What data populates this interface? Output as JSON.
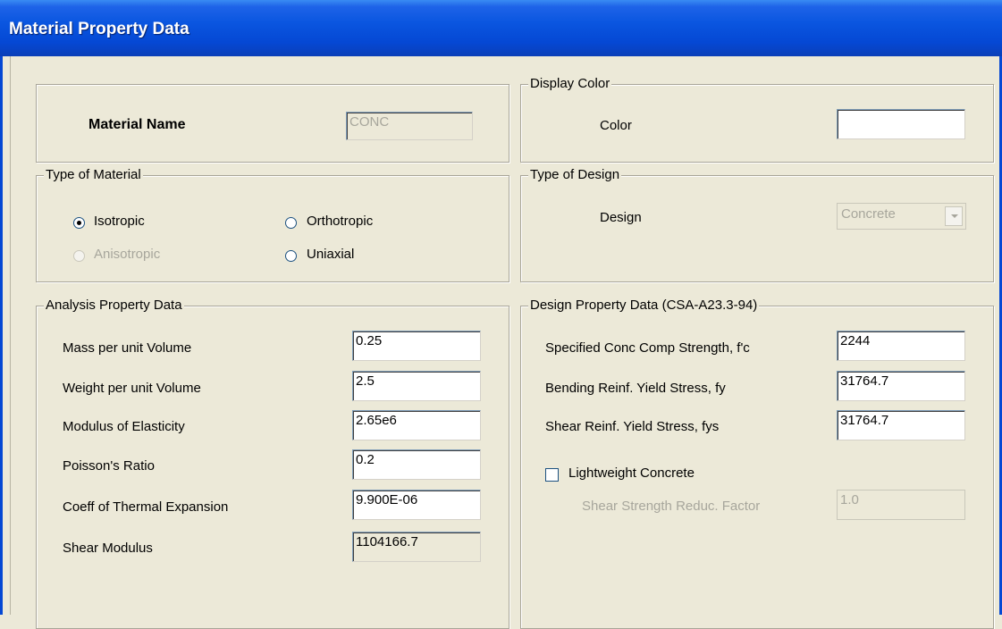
{
  "window": {
    "title": "Material Property Data"
  },
  "material_name": {
    "label": "Material Name",
    "value": "CONC"
  },
  "display_color": {
    "legend": "Display Color",
    "label": "Color",
    "value": ""
  },
  "type_of_material": {
    "legend": "Type of Material",
    "options": [
      {
        "label": "Isotropic",
        "checked": true,
        "enabled": true
      },
      {
        "label": "Orthotropic",
        "checked": false,
        "enabled": true
      },
      {
        "label": "Anisotropic",
        "checked": false,
        "enabled": false
      },
      {
        "label": "Uniaxial",
        "checked": false,
        "enabled": true
      }
    ]
  },
  "type_of_design": {
    "legend": "Type of Design",
    "label": "Design",
    "value": "Concrete"
  },
  "analysis": {
    "legend": "Analysis Property Data",
    "rows": [
      {
        "label": "Mass per unit Volume",
        "value": "0.25"
      },
      {
        "label": "Weight per unit Volume",
        "value": "2.5"
      },
      {
        "label": "Modulus of Elasticity",
        "value": "2.65e6"
      },
      {
        "label": "Poisson's Ratio",
        "value": "0.2"
      },
      {
        "label": "Coeff of Thermal Expansion",
        "value": "9.900E-06"
      },
      {
        "label": "Shear Modulus",
        "value": "1104166.7"
      }
    ]
  },
  "design": {
    "legend": "Design Property Data (CSA-A23.3-94)",
    "rows": [
      {
        "label": "Specified Conc Comp Strength, f'c",
        "value": "2244"
      },
      {
        "label": "Bending Reinf. Yield Stress, fy",
        "value": "31764.7"
      },
      {
        "label": "Shear Reinf. Yield Stress, fys",
        "value": "31764.7"
      }
    ],
    "lightweight": {
      "label": "Lightweight Concrete",
      "checked": false
    },
    "reduction": {
      "label": "Shear Strength Reduc. Factor",
      "value": "1.0"
    }
  }
}
